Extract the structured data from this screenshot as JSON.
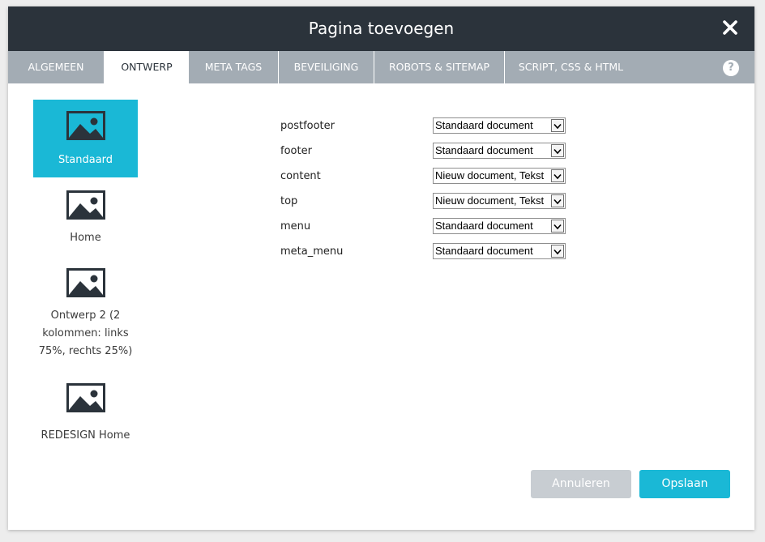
{
  "dialog": {
    "title": "Pagina toevoegen"
  },
  "tabs": [
    {
      "label": "ALGEMEEN",
      "active": false
    },
    {
      "label": "ONTWERP",
      "active": true
    },
    {
      "label": "META TAGS",
      "active": false
    },
    {
      "label": "BEVEILIGING",
      "active": false
    },
    {
      "label": "ROBOTS & SITEMAP",
      "active": false
    },
    {
      "label": "SCRIPT, CSS & HTML",
      "active": false
    }
  ],
  "help": {
    "label": "?"
  },
  "templates": [
    {
      "label": "Standaard",
      "selected": true
    },
    {
      "label": "Home",
      "selected": false
    },
    {
      "label": "Ontwerp 2 (2 kolommen: links 75%, rechts 25%)",
      "selected": false
    },
    {
      "label": "REDESIGN Home",
      "selected": false
    }
  ],
  "regions": [
    {
      "label": "postfooter",
      "value": "Standaard document"
    },
    {
      "label": "footer",
      "value": "Standaard document"
    },
    {
      "label": "content",
      "value": "Nieuw document, Tekst"
    },
    {
      "label": "top",
      "value": "Nieuw document, Tekst"
    },
    {
      "label": "menu",
      "value": "Standaard document"
    },
    {
      "label": "meta_menu",
      "value": "Standaard document"
    }
  ],
  "buttons": {
    "cancel": "Annuleren",
    "save": "Opslaan"
  },
  "colors": {
    "titlebar": "#2b333b",
    "tabbar": "#a3acb4",
    "accent": "#1ab8d6",
    "cancel": "#c8cdd2"
  },
  "icons": {
    "close": "close-icon",
    "help": "help-icon",
    "template": "image-icon",
    "dropdown": "chevron-down-icon"
  }
}
